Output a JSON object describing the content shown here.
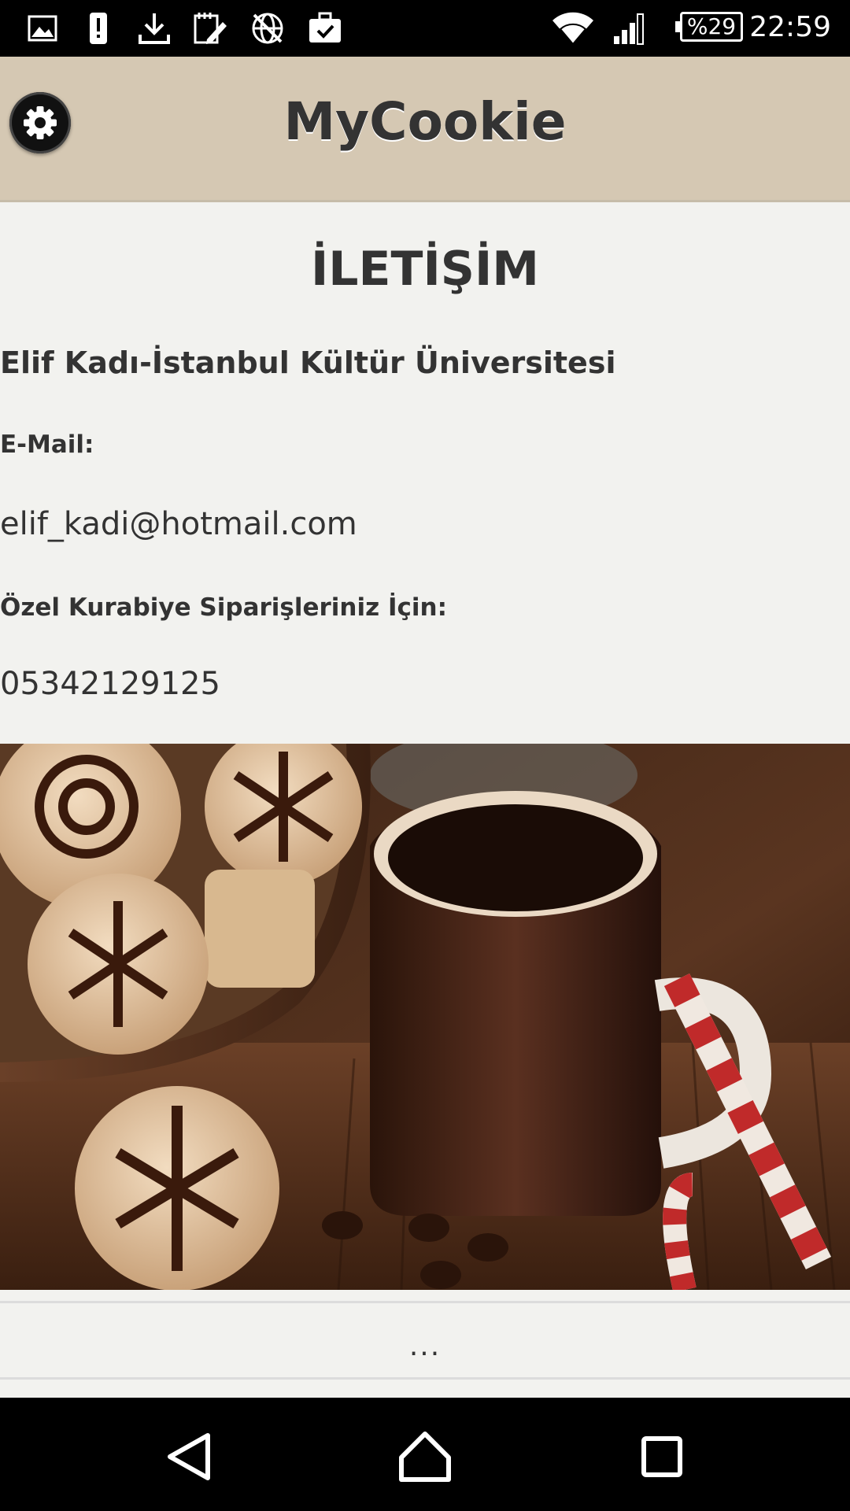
{
  "status_bar": {
    "battery_text": "%29",
    "time": "22:59",
    "icons": [
      "image-icon",
      "alert-icon",
      "download-icon",
      "note-edit-icon",
      "globe-off-icon",
      "briefcase-check-icon",
      "wifi-icon",
      "signal-icon",
      "battery-icon"
    ]
  },
  "header": {
    "title": "MyCookie",
    "settings_icon": "gear-icon"
  },
  "contact": {
    "title": "İLETİŞİM",
    "person": "Elif Kadı-İstanbul Kültür Üniversitesi",
    "email_label": "E-Mail:",
    "email": "elif_kadi@hotmail.com",
    "order_label": "Özel Kurabiye Siparişleriniz İçin:",
    "phone": "05342129125"
  },
  "footer": {
    "more": "..."
  },
  "nav": {
    "icons": [
      "back-icon",
      "home-icon",
      "recents-icon"
    ]
  }
}
